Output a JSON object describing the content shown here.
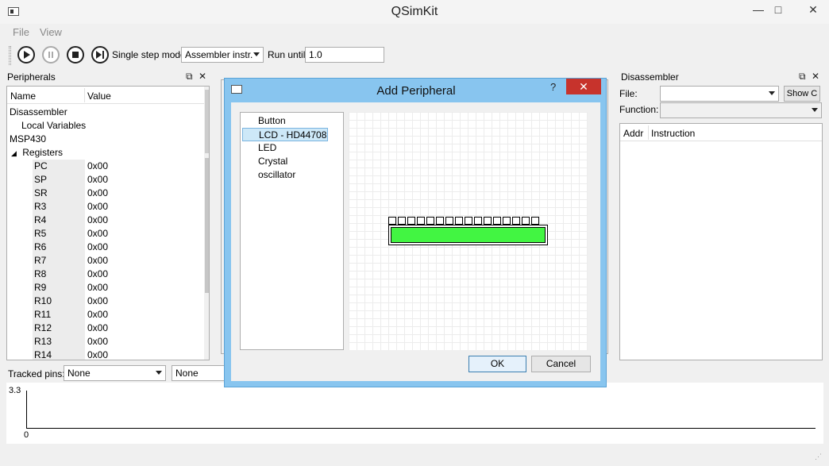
{
  "window": {
    "title": "QSimKit",
    "minimize": "—",
    "maximize": "□",
    "close": "✕"
  },
  "menu": [
    {
      "label": "File"
    },
    {
      "label": "View"
    }
  ],
  "toolbar": {
    "single_step_label": "Single step mode:",
    "single_step_value": "Assembler instr.",
    "run_until_label": "Run until:",
    "run_until_value": "1.0"
  },
  "peripherals": {
    "title": "Peripherals",
    "columns": [
      "Name",
      "Value"
    ],
    "tree": {
      "disassembler": "Disassembler",
      "local_variables": "Local Variables",
      "msp430": "MSP430",
      "registers": "Registers"
    },
    "registers": [
      {
        "name": "PC",
        "value": "0x00"
      },
      {
        "name": "SP",
        "value": "0x00"
      },
      {
        "name": "SR",
        "value": "0x00"
      },
      {
        "name": "R3",
        "value": "0x00"
      },
      {
        "name": "R4",
        "value": "0x00"
      },
      {
        "name": "R5",
        "value": "0x00"
      },
      {
        "name": "R6",
        "value": "0x00"
      },
      {
        "name": "R7",
        "value": "0x00"
      },
      {
        "name": "R8",
        "value": "0x00"
      },
      {
        "name": "R9",
        "value": "0x00"
      },
      {
        "name": "R10",
        "value": "0x00"
      },
      {
        "name": "R11",
        "value": "0x00"
      },
      {
        "name": "R12",
        "value": "0x00"
      },
      {
        "name": "R13",
        "value": "0x00"
      },
      {
        "name": "R14",
        "value": "0x00"
      }
    ]
  },
  "tracked": {
    "label": "Tracked pins:",
    "pin1": "None",
    "pin2": "None"
  },
  "plot": {
    "y_max": "3.3",
    "y_min": "0"
  },
  "disassembler": {
    "title": "Disassembler",
    "file_label": "File:",
    "function_label": "Function:",
    "show_button": "Show C",
    "columns": [
      "Addr",
      "Instruction"
    ]
  },
  "dialog": {
    "title": "Add Peripheral",
    "help": "?",
    "close": "✕",
    "items": [
      {
        "label": "Button"
      },
      {
        "label": "LCD - HD44708"
      },
      {
        "label": "LED"
      },
      {
        "label": "Crystal oscillator"
      }
    ],
    "selected_index": 1,
    "ok": "OK",
    "cancel": "Cancel"
  },
  "colors": {
    "lcd_screen": "#42f542",
    "dialog_frame": "#88c5ef",
    "close_red": "#c7332c"
  }
}
